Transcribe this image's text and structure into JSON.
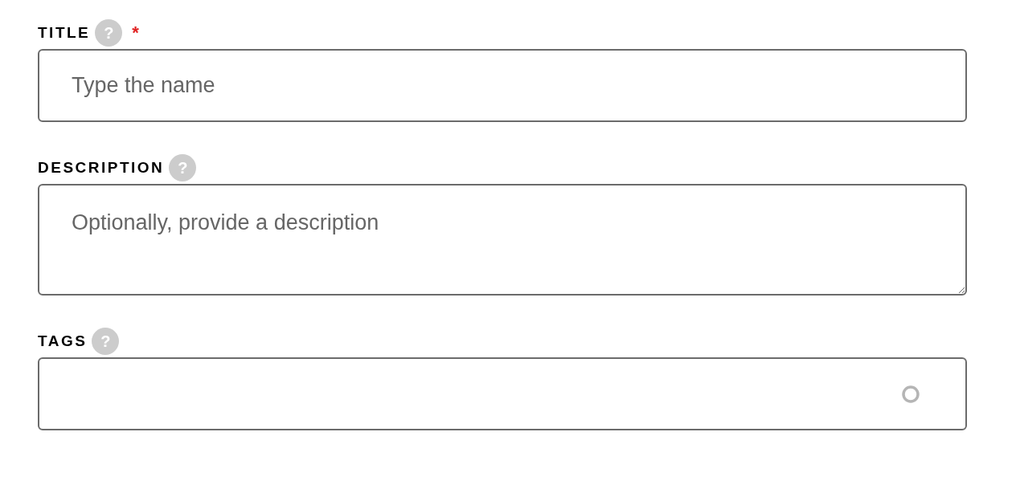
{
  "fields": [
    {
      "kind": "text",
      "label": "TITLE",
      "help": "?",
      "required_mark": "*",
      "placeholder": "Type the name"
    },
    {
      "kind": "textarea",
      "label": "DESCRIPTION",
      "help": "?",
      "placeholder": "Optionally, provide a description"
    },
    {
      "kind": "tags",
      "label": "TAGS",
      "help": "?",
      "loading": true
    }
  ]
}
